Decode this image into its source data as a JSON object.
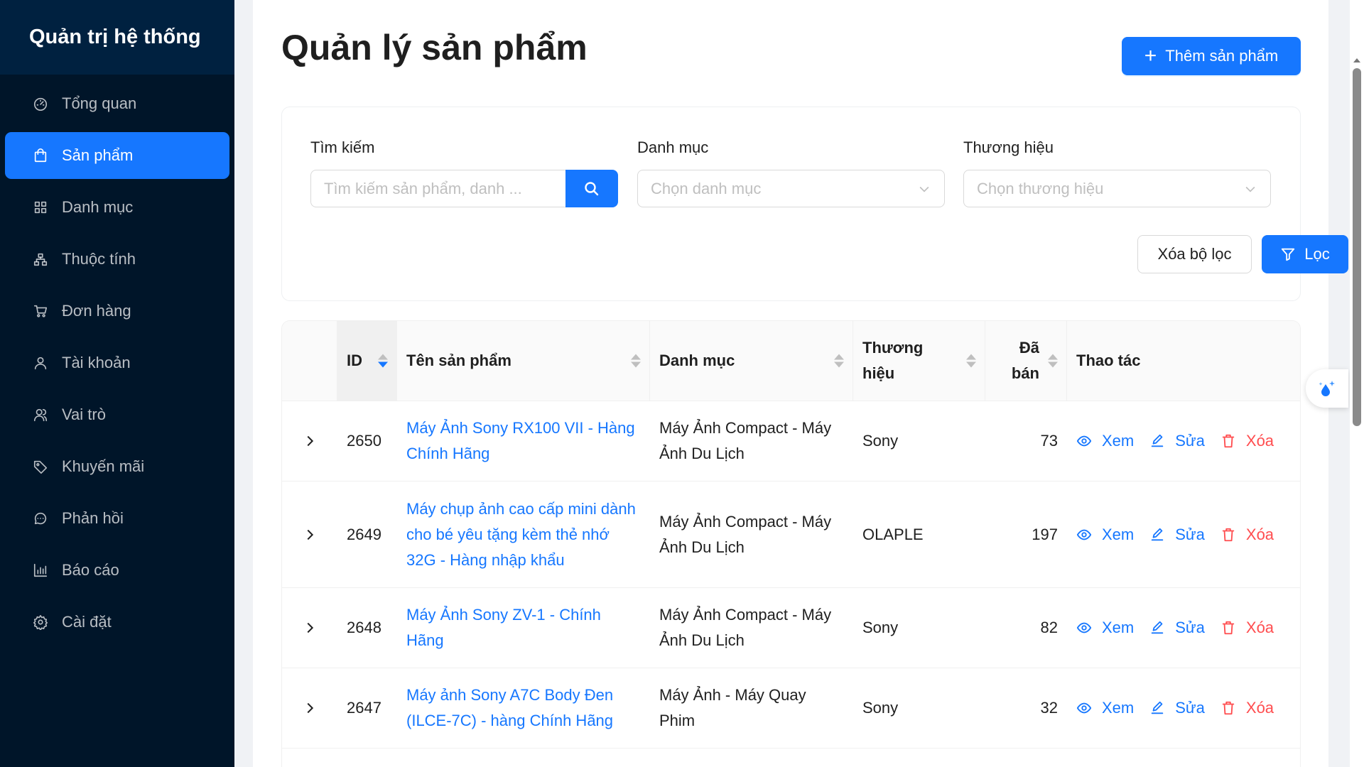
{
  "sidebar": {
    "brand": "Quản trị hệ thống",
    "items": [
      {
        "label": "Tổng quan",
        "icon": "dashboard-icon"
      },
      {
        "label": "Sản phẩm",
        "icon": "shopping-bag-icon",
        "active": true
      },
      {
        "label": "Danh mục",
        "icon": "grid-icon"
      },
      {
        "label": "Thuộc tính",
        "icon": "hierarchy-icon"
      },
      {
        "label": "Đơn hàng",
        "icon": "cart-icon"
      },
      {
        "label": "Tài khoản",
        "icon": "user-icon"
      },
      {
        "label": "Vai trò",
        "icon": "team-icon"
      },
      {
        "label": "Khuyến mãi",
        "icon": "tag-icon"
      },
      {
        "label": "Phản hồi",
        "icon": "chat-icon"
      },
      {
        "label": "Báo cáo",
        "icon": "bar-chart-icon"
      },
      {
        "label": "Cài đặt",
        "icon": "gear-icon"
      }
    ]
  },
  "header": {
    "title": "Quản lý sản phẩm",
    "add_label": "Thêm sản phẩm"
  },
  "filters": {
    "search_label": "Tìm kiếm",
    "search_placeholder": "Tìm kiếm sản phẩm, danh ...",
    "category_label": "Danh mục",
    "category_placeholder": "Chọn danh mục",
    "brand_label": "Thương hiệu",
    "brand_placeholder": "Chọn thương hiệu",
    "clear_label": "Xóa bộ lọc",
    "filter_label": "Lọc"
  },
  "table": {
    "columns": {
      "id": "ID",
      "name": "Tên sản phẩm",
      "category": "Danh mục",
      "brand_l1": "Thương",
      "brand_l2": "hiệu",
      "sold_l1": "Đã",
      "sold_l2": "bán",
      "actions": "Thao tác"
    },
    "action_labels": {
      "view": "Xem",
      "edit": "Sửa",
      "delete": "Xóa"
    },
    "rows": [
      {
        "id": "2650",
        "name": "Máy Ảnh Sony RX100 VII - Hàng Chính Hãng",
        "category": "Máy Ảnh Compact - Máy Ảnh Du Lịch",
        "brand": "Sony",
        "sold": "73"
      },
      {
        "id": "2649",
        "name": "Máy chụp ảnh cao cấp mini dành cho bé yêu tặng kèm thẻ nhớ 32G - Hàng nhập khẩu",
        "category": "Máy Ảnh Compact - Máy Ảnh Du Lịch",
        "brand": "OLAPLE",
        "sold": "197"
      },
      {
        "id": "2648",
        "name": "Máy Ảnh Sony ZV-1 - Chính Hãng",
        "category": "Máy Ảnh Compact - Máy Ảnh Du Lịch",
        "brand": "Sony",
        "sold": "82"
      },
      {
        "id": "2647",
        "name": "Máy ảnh Sony A7C Body Đen (ILCE-7C) - hàng Chính Hãng",
        "category": "Máy Ảnh - Máy Quay Phim",
        "brand": "Sony",
        "sold": "32"
      }
    ]
  },
  "colors": {
    "primary": "#1677ff",
    "danger": "#ff4d4f",
    "sidebar_bg": "#001529"
  }
}
